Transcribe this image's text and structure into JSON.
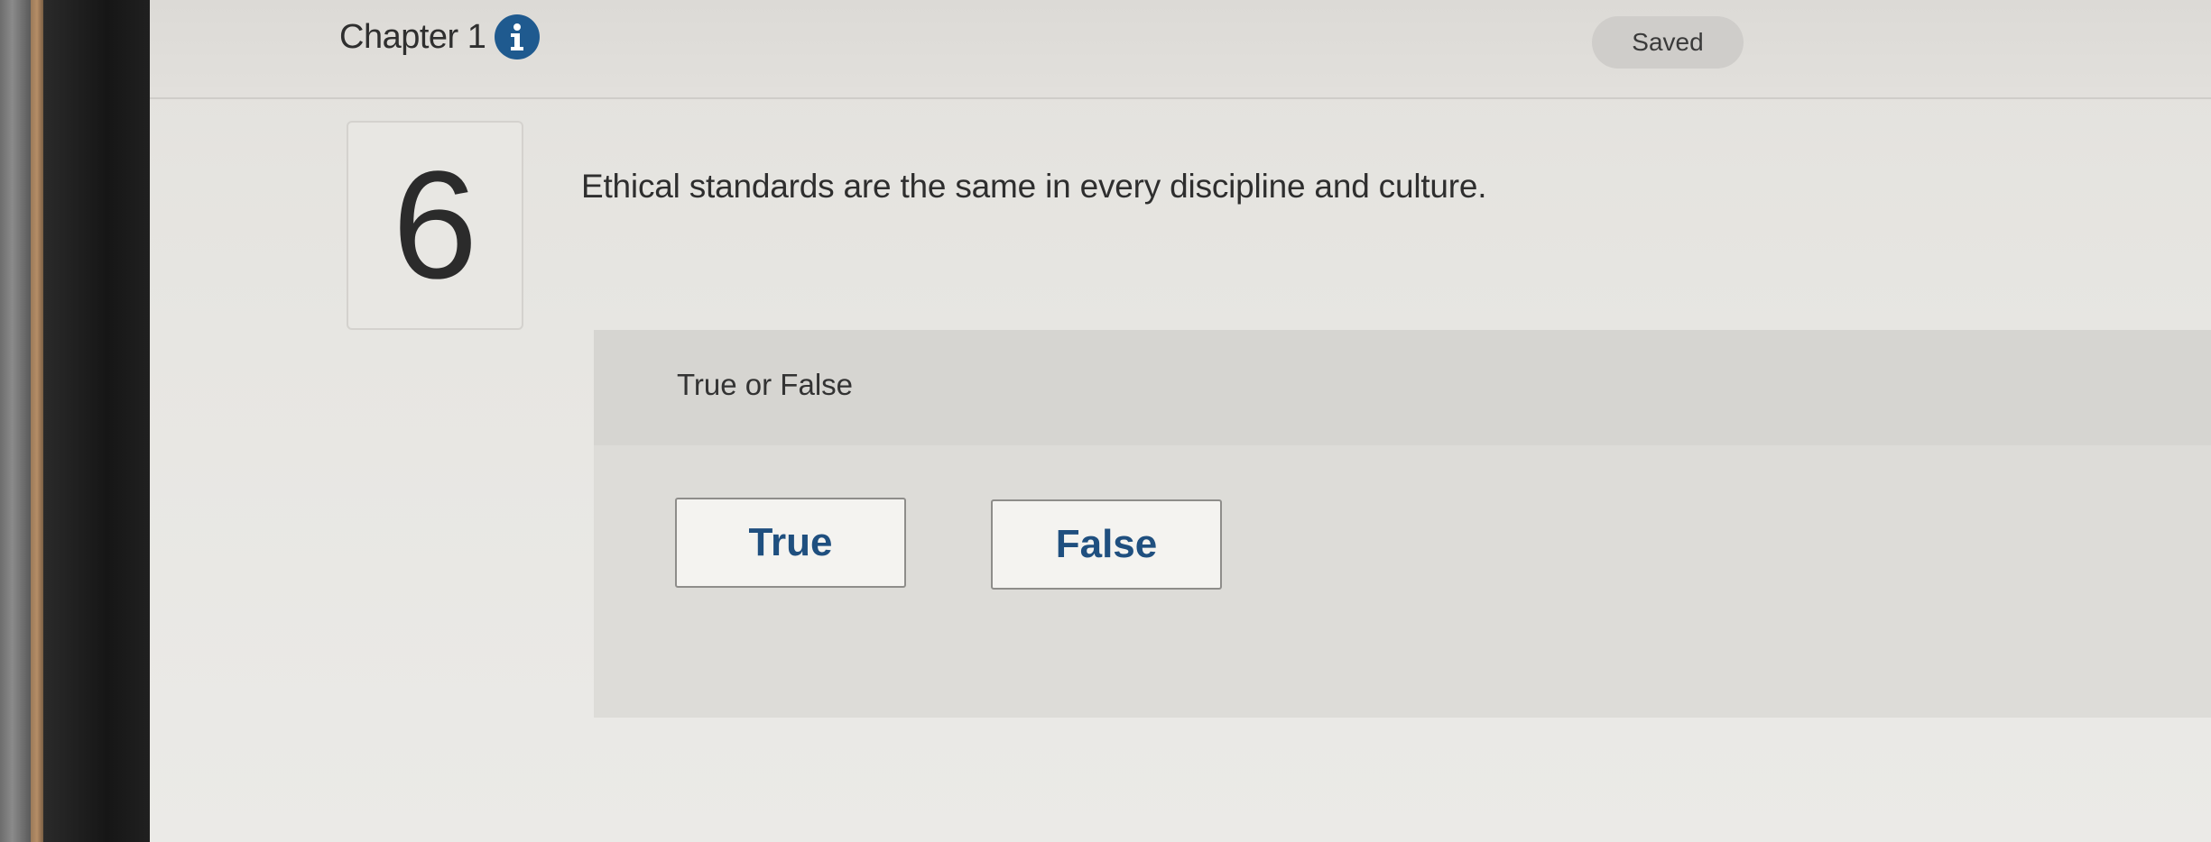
{
  "header": {
    "chapter_title": "Chapter 1",
    "status": "Saved"
  },
  "question": {
    "number": "6",
    "text": "Ethical standards are the same in every discipline and culture.",
    "type_label": "True or False",
    "choices": [
      {
        "label": "True"
      },
      {
        "label": "False"
      }
    ]
  },
  "colors": {
    "accent": "#1f5a8f",
    "choice_text": "#1f4f7f"
  },
  "icons": {
    "info": "info-icon"
  }
}
